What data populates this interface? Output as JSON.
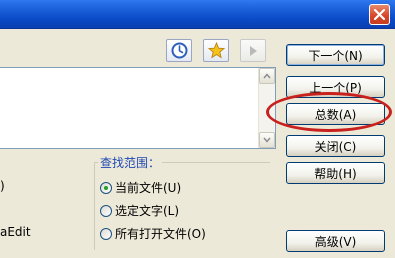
{
  "window": {
    "close_glyph": "✕"
  },
  "toolbar": {
    "icons": [
      "clock-icon",
      "star-icon",
      "play-icon"
    ]
  },
  "left_partial_text": {
    "line1": ")",
    "line2": "aEdit"
  },
  "buttons": {
    "find_next": "下一个(N)",
    "find_prev": "上一个(P)",
    "count": "总数(A)",
    "close": "关闭(C)",
    "help": "帮助(H)",
    "advanced": "高级(V)"
  },
  "search_scope": {
    "label": "查找范围：",
    "options": [
      {
        "label": "当前文件(U)",
        "checked": true
      },
      {
        "label": "选定文字(L)",
        "checked": false
      },
      {
        "label": "所有打开文件(O)",
        "checked": false
      }
    ]
  },
  "colors": {
    "titlebar": "#0a49c6",
    "dialog_bg": "#ece9d8",
    "highlight": "#c8201c",
    "group_label": "#1f48b4"
  }
}
